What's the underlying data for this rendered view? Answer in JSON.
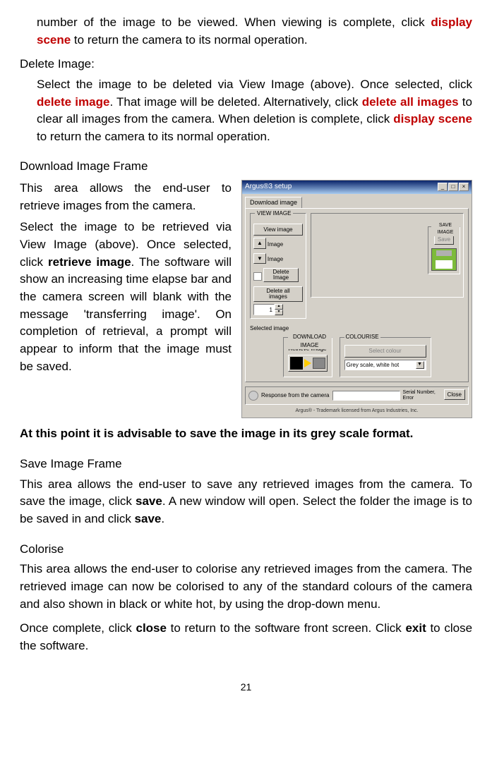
{
  "intro": {
    "line1_pre": "number of the image to be viewed. When viewing is complete, click ",
    "display_scene": "display scene",
    "line1_post": " to return the camera to its normal operation."
  },
  "delete": {
    "heading": "Delete Image:",
    "p_pre": "Select the image to be deleted via View Image (above). Once selected, click ",
    "delete_image": "delete image",
    "p_mid1": ". That image will be deleted. Alternatively, click ",
    "delete_all": "delete all images",
    "p_mid2": " to clear all images from the camera. When deletion is complete, click ",
    "display_scene": "display scene",
    "p_post": " to return the camera to its normal operation."
  },
  "download": {
    "heading": "Download Image Frame",
    "p1": "This area allows the end-user to retrieve images from the camera.",
    "p2_pre": "Select the image to be retrieved via View Image (above). Once selected, click ",
    "retrieve_image": "retrieve image",
    "p2_post": ". The software will show an increasing time elapse bar and the camera screen will blank with the message 'transferring image'. On completion of retrieval, a prompt will appear to inform that the image must be saved."
  },
  "advice": "At this point it is advisable to save the image in its grey scale format.",
  "save": {
    "heading": "Save Image Frame",
    "p_pre": "This area allows the end-user to save any retrieved images from the camera. To save the image, click ",
    "save_word": "save",
    "p_mid": ". A new window will open. Select the folder the image is to be saved in and click ",
    "p_post": "."
  },
  "colorise": {
    "heading": "Colorise",
    "p1": "This area allows the end-user to colorise any retrieved images from the camera. The retrieved image can now be colorised to any of the standard colours of the camera and also shown in black or white hot, by using the drop-down menu.",
    "p2_pre": "Once complete, click ",
    "close_word": "close",
    "p2_mid": " to return to the software front screen. Click ",
    "exit_word": "exit",
    "p2_post": " to close the software."
  },
  "app": {
    "title": "Argus®3 setup",
    "tab": "Download image",
    "group_view": "VIEW IMAGE",
    "btn_view": "View image",
    "label_image": "Image",
    "btn_delete": "Delete Image",
    "btn_delete_all": "Delete all images",
    "spinner_value": "1",
    "selected_image": "Selected image",
    "group_save": "SAVE IMAGE",
    "btn_save": "Save",
    "group_download": "DOWNLOAD IMAGE",
    "btn_retrieve": "Retrieve Image",
    "group_colourise": "COLOURISE",
    "btn_select_colour": "Select colour",
    "combo_value": "Grey scale, white hot",
    "status_label": "Response from the camera",
    "serial_label": "Serial Number, Error",
    "btn_close": "Close",
    "trademark": "Argus® - Trademark licensed from Argus Industries, Inc."
  },
  "page_number": "21"
}
